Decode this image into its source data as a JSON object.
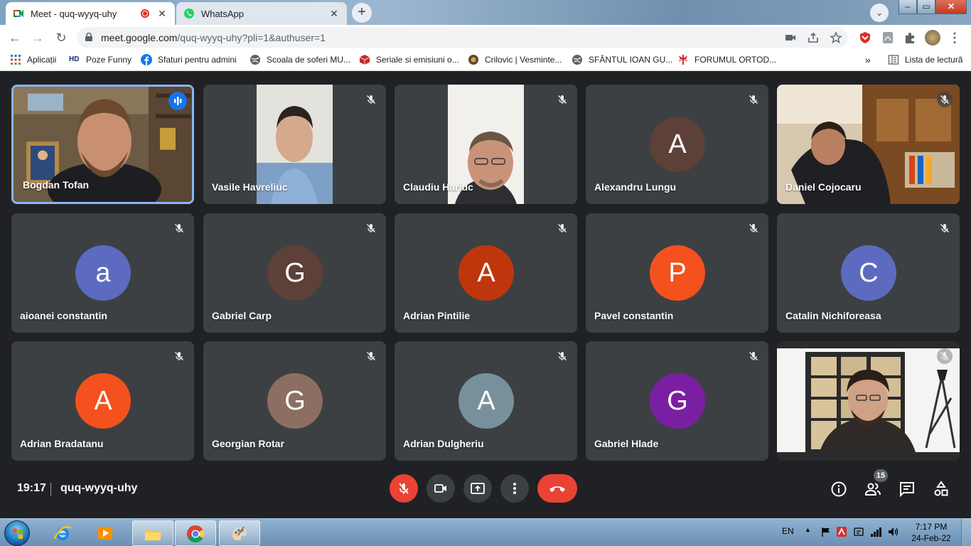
{
  "browser": {
    "tabs": [
      {
        "title": "Meet - quq-wyyq-uhy",
        "active": true,
        "recording": true,
        "icon": "google-meet-icon"
      },
      {
        "title": "WhatsApp",
        "active": false,
        "icon": "whatsapp-icon"
      }
    ],
    "url_host": "meet.google.com",
    "url_path": "/quq-wyyq-uhy?pli=1&authuser=1"
  },
  "bookmarks": {
    "items": [
      {
        "label": "Aplicații",
        "icon": "apps-grid-icon"
      },
      {
        "label": "Poze Funny",
        "icon": "hd-icon"
      },
      {
        "label": "Sfaturi pentru admini",
        "icon": "facebook-icon"
      },
      {
        "label": "Scoala de soferi MU...",
        "icon": "globe-icon"
      },
      {
        "label": "Seriale si emisiuni o...",
        "icon": "cube-icon"
      },
      {
        "label": "Crilovic | Vesminte...",
        "icon": "crilovic-icon"
      },
      {
        "label": "SFÂNTUL IOAN GU...",
        "icon": "globe-icon"
      },
      {
        "label": "FORUMUL ORTOD...",
        "icon": "cross-icon"
      }
    ],
    "overflow": "»",
    "reading_list": "Lista de lectură"
  },
  "participants": [
    {
      "name": "Bogdan Tofan",
      "video": true,
      "speaking": true
    },
    {
      "name": "Vasile Havreliuc",
      "video": true,
      "muted": true
    },
    {
      "name": "Claudiu Hariuc",
      "video": true,
      "muted": true
    },
    {
      "name": "Alexandru Lungu",
      "initial": "A",
      "color": "#5d4037",
      "muted": true
    },
    {
      "name": "Daniel Cojocaru",
      "video": true,
      "muted": true
    },
    {
      "name": "aioanei constantin",
      "initial": "a",
      "color": "#5c6bc0",
      "muted": true
    },
    {
      "name": "Gabriel Carp",
      "initial": "G",
      "color": "#5d4037",
      "muted": true
    },
    {
      "name": "Adrian Pintilie",
      "initial": "A",
      "color": "#bf360c",
      "muted": true
    },
    {
      "name": "Pavel constantin",
      "initial": "P",
      "color": "#f4511e",
      "muted": true
    },
    {
      "name": "Catalin Nichiforeasa",
      "initial": "C",
      "color": "#5c6bc0",
      "muted": true
    },
    {
      "name": "Adrian Bradatanu",
      "initial": "A",
      "color": "#f4511e",
      "muted": true
    },
    {
      "name": "Georgian Rotar",
      "initial": "G",
      "color": "#8d6e63",
      "muted": true
    },
    {
      "name": "Adrian Dulgheriu",
      "initial": "A",
      "color": "#78909c",
      "muted": true
    },
    {
      "name": "Gabriel Hlade",
      "initial": "G",
      "color": "#7b1fa2",
      "muted": true
    },
    {
      "name": "",
      "video": true,
      "muted": true
    }
  ],
  "meeting": {
    "time": "19:17",
    "code": "quq-wyyq-uhy",
    "participant_count": "15"
  },
  "taskbar": {
    "language": "EN",
    "time": "7:17 PM",
    "date": "24-Feb-22"
  },
  "colors": {
    "meet_bg": "#202124",
    "tile_bg": "#3c4043",
    "end_call": "#ea4335",
    "speaking_border": "#8ab4f8"
  }
}
